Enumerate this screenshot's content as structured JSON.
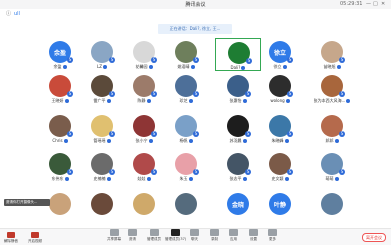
{
  "window": {
    "title": "腾讯会议",
    "controls": [
      "05:29:31",
      "—",
      "□",
      "✕"
    ]
  },
  "topbar": {
    "left_items": [
      "ⓘ",
      "ull"
    ]
  },
  "notice": {
    "text": "正在讲话：Dali?, 徐立, 王..."
  },
  "participants": [
    {
      "name": "余盈",
      "avatar_text": "余盈",
      "avatar_color": "#2f7be8",
      "mic": true
    },
    {
      "name": "LZ",
      "avatar_color": "#8aa6c4",
      "mic": true
    },
    {
      "name": "花馨园",
      "avatar_color": "#d8d8d8",
      "mic": true
    },
    {
      "name": "姚语晴",
      "avatar_color": "#6e7f5c",
      "mic": true
    },
    {
      "name": "Dali?",
      "avatar_color": "#1e7d33",
      "mic": true,
      "highlighted": true
    },
    {
      "name": "徐立",
      "avatar_text": "徐立",
      "avatar_color": "#2f7be8",
      "mic": true
    },
    {
      "name": "苗晓旭",
      "avatar_color": "#c6a78b",
      "mic": true
    },
    {
      "name": "王晓妍",
      "avatar_color": "#c94b3a",
      "mic": true
    },
    {
      "name": "雷广平",
      "avatar_color": "#5b4a3a",
      "mic": true
    },
    {
      "name": "陈静",
      "avatar_color": "#9c7b6a",
      "mic": true
    },
    {
      "name": "珍芝",
      "avatar_color": "#4d6f99",
      "mic": true
    },
    {
      "name": "张惠怡",
      "avatar_color": "#3b5f8a",
      "mic": true
    },
    {
      "name": "wolong",
      "avatar_color": "#2d2d2d",
      "mic": true
    },
    {
      "name": "张为本西大风海...",
      "avatar_color": "#a8663c",
      "mic": true
    },
    {
      "name": "Chris",
      "avatar_color": "#7a5d4c",
      "mic": true
    },
    {
      "name": "管瑶瑶",
      "avatar_color": "#e0c070",
      "mic": true
    },
    {
      "name": "张小宁",
      "avatar_color": "#8e3535",
      "mic": true
    },
    {
      "name": "杨帆",
      "avatar_color": "#7aa0c8",
      "mic": true
    },
    {
      "name": "苏羽晨",
      "avatar_color": "#1d1d1d",
      "mic": true
    },
    {
      "name": "朱晓峰",
      "avatar_color": "#3c78a8",
      "mic": true
    },
    {
      "name": "邦邦",
      "avatar_color": "#b56a4c",
      "mic": true
    },
    {
      "name": "东伟东",
      "avatar_color": "#3a5a3a",
      "mic": true
    },
    {
      "name": "史楠楠",
      "avatar_color": "#6b6b6b",
      "mic": true
    },
    {
      "name": "娃娃",
      "avatar_color": "#b04a4a",
      "mic": true
    },
    {
      "name": "朱玉",
      "avatar_color": "#e8a0a8",
      "mic": true
    },
    {
      "name": "张志平",
      "avatar_color": "#445566",
      "mic": true
    },
    {
      "name": "史文颖",
      "avatar_color": "#7b5a48",
      "mic": true
    },
    {
      "name": "萌萌",
      "avatar_color": "#6a8fb5",
      "mic": true
    },
    {
      "name": "",
      "avatar_color": "#c9a27a",
      "mic": false
    },
    {
      "name": "",
      "avatar_color": "#6a4a3a",
      "mic": false
    },
    {
      "name": "",
      "avatar_color": "#cfa96a",
      "mic": false
    },
    {
      "name": "",
      "avatar_color": "#556b7d",
      "mic": false
    },
    {
      "name": "",
      "avatar_text": "金晓",
      "avatar_color": "#2f7be8",
      "mic": false
    },
    {
      "name": "",
      "avatar_text": "叶静",
      "avatar_color": "#2f7be8",
      "mic": false
    },
    {
      "name": "",
      "avatar_color": "#5f7f9f",
      "mic": false
    }
  ],
  "toast": {
    "text": "邀请你打开摄像头..."
  },
  "self": [
    {
      "label": "解除静音"
    },
    {
      "label": "开启视频"
    }
  ],
  "bottom_buttons": [
    {
      "label": "共享屏幕",
      "icon": "screen-share-icon"
    },
    {
      "label": "邀请",
      "icon": "invite-icon"
    },
    {
      "label": "管理成员",
      "icon": "members-icon"
    },
    {
      "label": "管理成员(37)",
      "icon": "members-count-icon"
    },
    {
      "label": "聊天",
      "icon": "chat-icon"
    },
    {
      "label": "录制",
      "icon": "record-icon"
    },
    {
      "label": "应用",
      "icon": "apps-icon"
    },
    {
      "label": "设置",
      "icon": "settings-icon"
    },
    {
      "label": "更多",
      "icon": "more-icon"
    }
  ],
  "leave_label": "离开会议"
}
